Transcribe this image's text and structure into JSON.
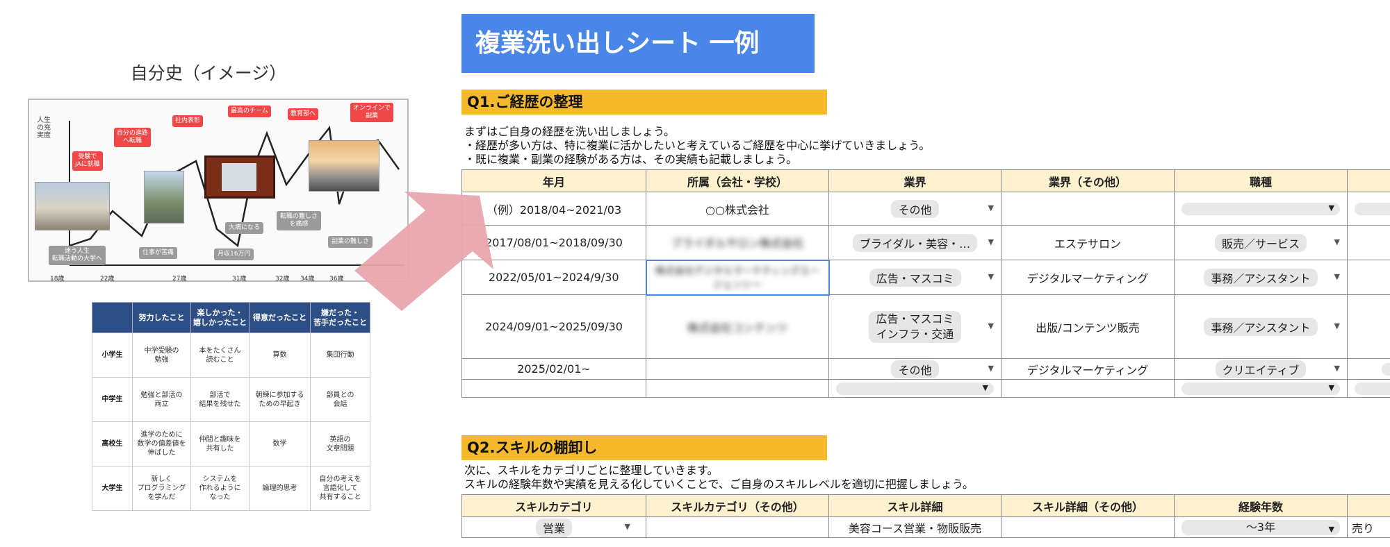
{
  "life_graph": {
    "title": "自分史（イメージ）",
    "y_label": "人生の充実度",
    "bubbles": [
      "受験で\nJAに就職",
      "自分の進路\nへ転職",
      "社内表彰",
      "最高のチーム",
      "教育部へ",
      "オンラインで\n副業"
    ],
    "lows": [
      "迷う人生\n転職活動の大学へ",
      "仕事が苦痛",
      "月収16万円",
      "大病になる",
      "転職の難しさ\nを痛感",
      "副業の難しさ"
    ],
    "ages": [
      "18歳",
      "22歳",
      "27歳",
      "31歳",
      "32歳",
      "34歳",
      "36歳"
    ]
  },
  "history_table": {
    "headers": [
      "",
      "努力したこと",
      "楽しかった・\n嬉しかったこと",
      "得意だったこと",
      "嫌だった・\n苦手だったこと"
    ],
    "rows": [
      [
        "小学生",
        "中学受験の\n勉強",
        "本をたくさん\n読むこと",
        "算数",
        "集団行動"
      ],
      [
        "中学生",
        "勉強と部活の\n両立",
        "部活で\n結果を残せた",
        "朝練に参加する\nための早起き",
        "部員との\n会話"
      ],
      [
        "高校生",
        "進学のために\n数学の偏差値を\n伸ばした",
        "仲間と趣味を\n共有した",
        "数学",
        "英語の\n文章問題"
      ],
      [
        "大学生",
        "新しく\nプログラミング\nを学んだ",
        "システムを\n作れるように\nなった",
        "論理的思考",
        "自分の考えを\n言語化して\n共有すること"
      ]
    ]
  },
  "sheet": {
    "title": "複業洗い出しシート 一例",
    "q1": {
      "heading": "Q1.ご経歴の整理",
      "instructions": [
        "まずはご自身の経歴を洗い出しましょう。",
        "・経歴が多い方は、特に複業に活かしたいと考えているご経歴を中心に挙げていきましょう。",
        "・既に複業・副業の経験がある方は、その実績も記載しましょう。"
      ],
      "columns": [
        "年月",
        "所属（会社・学校）",
        "業界",
        "業界（その他）",
        "職種"
      ],
      "rows": [
        {
          "period": "（例）2018/04~2021/03",
          "org": "○○株式会社",
          "industry": "その他",
          "industry_other": "",
          "job": ""
        },
        {
          "period": "2017/08/01~2018/09/30",
          "org": "ブライダルサロン株式会社",
          "industry": "ブライダル・美容・…",
          "industry_other": "エステサロン",
          "job": "販売／サービス"
        },
        {
          "period": "2022/05/01~2024/9/30",
          "org": "株式会社デジタルマーケティングエージェンシー",
          "industry": "広告・マスコミ",
          "industry_other": "デジタルマーケティング",
          "job": "事務／アシスタント"
        },
        {
          "period": "2024/09/01~2025/09/30",
          "org": "株式会社コンテンツ",
          "industry": "広告・マスコミ\nインフラ・交通",
          "industry_other": "出版/コンテンツ販売",
          "job": "事務／アシスタント"
        },
        {
          "period": "2025/02/01~",
          "org": "",
          "industry": "その他",
          "industry_other": "デジタルマーケティング",
          "job": "クリエイティブ"
        },
        {
          "period": "",
          "org": "",
          "industry": "",
          "industry_other": "",
          "job": ""
        }
      ]
    },
    "q2": {
      "heading": "Q2.スキルの棚卸し",
      "instructions": [
        "次に、スキルをカテゴリごとに整理していきます。",
        "スキルの経験年数や実績を見える化していくことで、ご自身のスキルレベルを適切に把握しましょう。"
      ],
      "columns": [
        "スキルカテゴリ",
        "スキルカテゴリ（その他）",
        "スキル詳細",
        "スキル詳細（その他）",
        "経験年数",
        ""
      ],
      "row": {
        "category": "営業",
        "category_other": "",
        "detail": "美容コース営業・物販販売",
        "detail_other": "",
        "years": "～3年",
        "extra": "売り"
      }
    }
  },
  "colors": {
    "sheet_title_bg": "#4a86e8",
    "section_bg": "#f7b92c",
    "header_bg": "#fdf1cf",
    "arrow": "#e8a7ad",
    "bubble": "#f04848",
    "table_header": "#2d4f86"
  }
}
